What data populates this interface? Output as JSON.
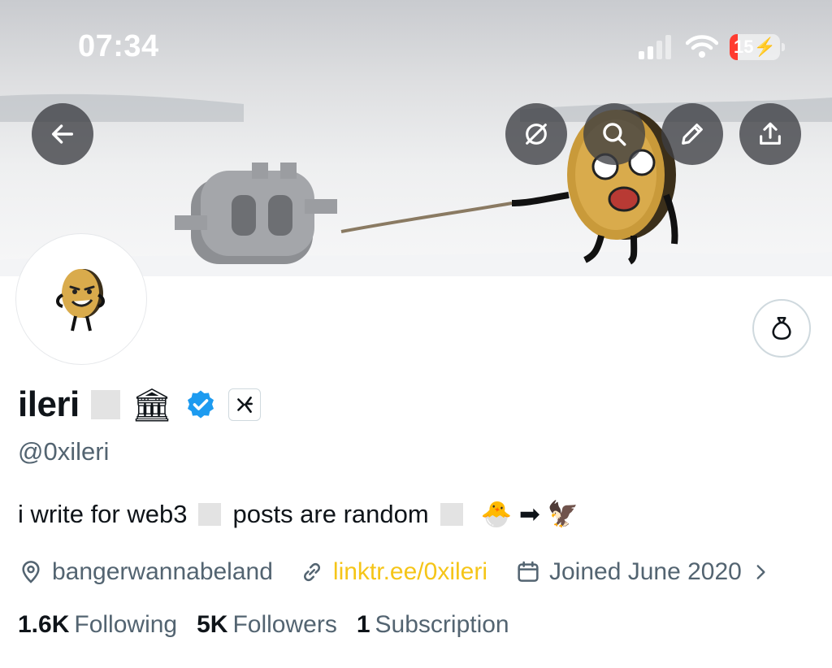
{
  "status_bar": {
    "time": "07:34",
    "battery": "15"
  },
  "banner_buttons": [
    "back-icon",
    "grok-icon",
    "search-icon",
    "edit-icon",
    "share-icon"
  ],
  "profile": {
    "display_name": "ileri",
    "handle": "@0xileri",
    "bio_part1": "i write for web3",
    "bio_part2": "posts are random",
    "bio_emoji": "🐣 ➡ 🦅",
    "name_emoji": "🏛",
    "location": "bangerwannabeland",
    "link": "linktr.ee/0xileri",
    "joined": "Joined June 2020",
    "stats": {
      "following_count": "1.6K",
      "following_label": "Following",
      "followers_count": "5K",
      "followers_label": "Followers",
      "subscription_count": "1",
      "subscription_label": "Subscription"
    }
  },
  "colors": {
    "accent_link": "#f5c518",
    "verified": "#1d9bf0",
    "secondary_text": "#536471"
  }
}
